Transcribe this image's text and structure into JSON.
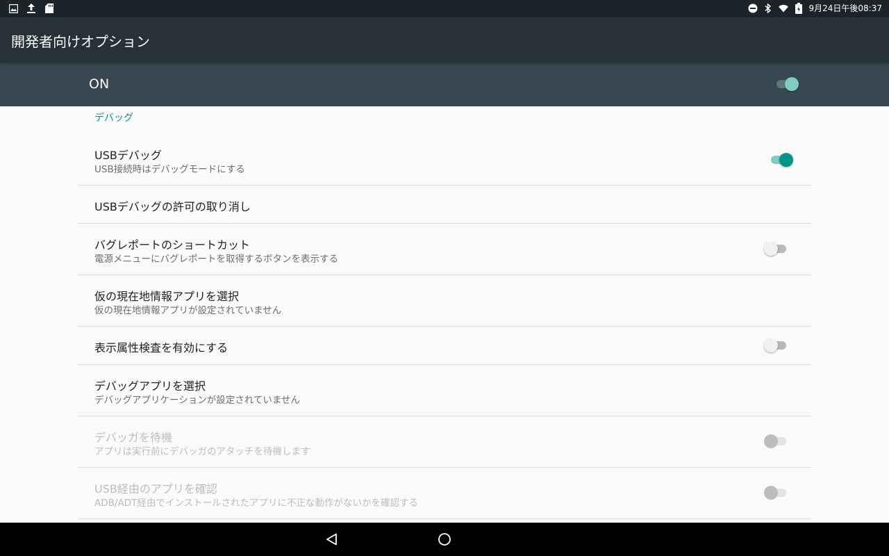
{
  "statusbar": {
    "left_icons": [
      "image-icon",
      "upload-icon",
      "sd-card-icon"
    ],
    "right_icons": [
      "do-not-disturb-icon",
      "bluetooth-icon",
      "wifi-icon",
      "battery-icon"
    ],
    "clock": "9月24日午後08:37"
  },
  "appbar": {
    "title": "開発者向けオプション"
  },
  "master_switch": {
    "label": "ON",
    "state": "on"
  },
  "category": "デバッグ",
  "preferences": [
    {
      "title": "USBデバッグ",
      "summary": "USB接続時はデバッグモードにする",
      "switch": "on",
      "enabled": true
    },
    {
      "title": "USBデバッグの許可の取り消し",
      "summary": "",
      "switch": null,
      "enabled": true
    },
    {
      "title": "バグレポートのショートカット",
      "summary": "電源メニューにバグレポートを取得するボタンを表示する",
      "switch": "off",
      "enabled": true
    },
    {
      "title": "仮の現在地情報アプリを選択",
      "summary": "仮の現在地情報アプリが設定されていません",
      "switch": null,
      "enabled": true
    },
    {
      "title": "表示属性検査を有効にする",
      "summary": "",
      "switch": "off",
      "enabled": true
    },
    {
      "title": "デバッグアプリを選択",
      "summary": "デバッグアプリケーションが設定されていません",
      "switch": null,
      "enabled": true
    },
    {
      "title": "デバッガを待機",
      "summary": "アプリは実行前にデバッガのアタッチを待機します",
      "switch": "off",
      "enabled": false
    },
    {
      "title": "USB経由のアプリを確認",
      "summary": "ADB/ADT経由でインストールされたアプリに不正な動作がないかを確認する",
      "switch": "off",
      "enabled": false
    }
  ],
  "navbar": {
    "icons": [
      "back-icon",
      "home-icon"
    ]
  },
  "colors": {
    "accent": "#009688",
    "appbar": "#263238",
    "switchbar": "#37474f"
  }
}
